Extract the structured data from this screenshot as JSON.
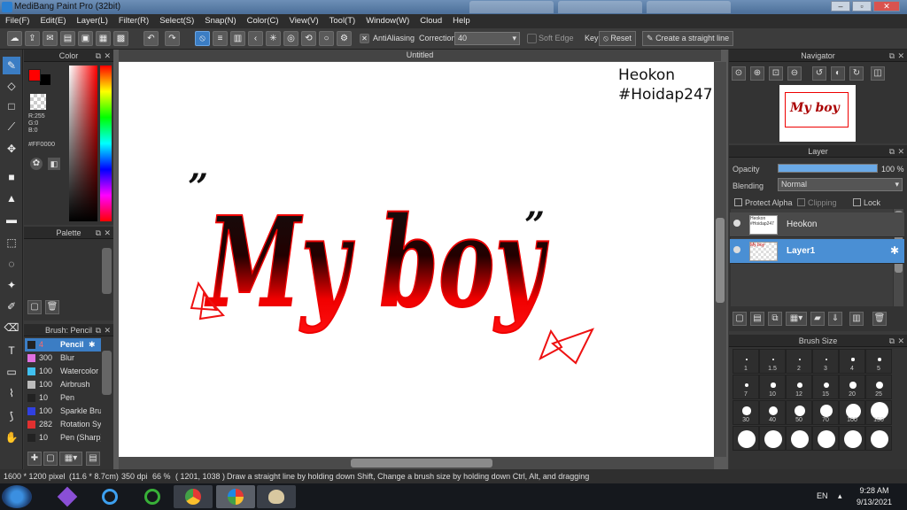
{
  "window": {
    "title": "MediBang Paint Pro (32bit)"
  },
  "menu": [
    "File(F)",
    "Edit(E)",
    "Layer(L)",
    "Filter(R)",
    "Select(S)",
    "Snap(N)",
    "Color(C)",
    "View(V)",
    "Tool(T)",
    "Window(W)",
    "Cloud",
    "Help"
  ],
  "toolbar": {
    "antialiasing_label": "AntiAliasing",
    "correction_label": "Correction",
    "correction_value": "40",
    "soft_edge_label": "Soft Edge",
    "key_label": "Key",
    "reset_label": "Reset",
    "straight_line_label": "Create a straight line"
  },
  "color_panel": {
    "title": "Color",
    "r": "R:255",
    "g": "G:0",
    "b": "B:0",
    "hex": "#FF0000",
    "primary": "#ff0000",
    "secondary": "#000000"
  },
  "palette_panel": {
    "title": "Palette",
    "swatches": [
      "#c8e8a0",
      "#a8e060",
      "#60d020",
      "#70e070",
      "#60c8a0",
      "#a0b8e0",
      "#a8a8f0",
      "#c8a8f0",
      "#e8e880",
      "#40a0f0",
      "#4060f0",
      "#a040f0",
      "#f040a0",
      "#f06020",
      "#f0a020",
      "#a0f040",
      "#f0a0c0",
      "#f0c0a0",
      "#f0e0a0",
      "#40e0e0",
      "#2040c0",
      "#c02020",
      "#802080",
      "#404040"
    ]
  },
  "brush_panel": {
    "title": "Brush: Pencil",
    "items": [
      {
        "size": "4",
        "name": "Pencil",
        "color": "#222222",
        "selected": true
      },
      {
        "size": "300",
        "name": "Blur",
        "color": "#e070e0"
      },
      {
        "size": "100",
        "name": "Watercolor",
        "color": "#40c0f0"
      },
      {
        "size": "100",
        "name": "Airbrush",
        "color": "#bbbbbb"
      },
      {
        "size": "10",
        "name": "Pen",
        "color": "#222222"
      },
      {
        "size": "100",
        "name": "Sparkle Brush",
        "color": "#3040e0"
      },
      {
        "size": "282",
        "name": "Rotation Symmetry",
        "color": "#e03030"
      },
      {
        "size": "10",
        "name": "Pen (Sharp)",
        "color": "#222222"
      }
    ]
  },
  "document": {
    "tab_title": "Untitled",
    "watermark_line1": "Heokon",
    "watermark_line2": "#Hoidap247",
    "artwork_text": "My boy",
    "quote_mark": "”"
  },
  "navigator": {
    "title": "Navigator",
    "preview_text": "My boy"
  },
  "layer_panel": {
    "title": "Layer",
    "opacity_label": "Opacity",
    "opacity_value": "100 %",
    "opacity_level": 1.0,
    "blending_label": "Blending",
    "blending_value": "Normal",
    "protect_alpha_label": "Protect Alpha",
    "clipping_label": "Clipping",
    "lock_label": "Lock",
    "layers": [
      {
        "name": "Heokon",
        "thumb": "Heokon #Hoidap247",
        "selected": false
      },
      {
        "name": "Layer1",
        "thumb": "My boy",
        "selected": true
      }
    ]
  },
  "brush_size_panel": {
    "title": "Brush Size",
    "sizes": [
      "1",
      "1.5",
      "2",
      "3",
      "4",
      "5",
      "7",
      "10",
      "12",
      "15",
      "20",
      "25",
      "30",
      "40",
      "50",
      "70",
      "100",
      "150",
      "",
      "",
      "",
      "",
      "",
      ""
    ]
  },
  "status": {
    "dimensions": "1600 * 1200 pixel",
    "physical": "(11.6 * 8.7cm)",
    "dpi": "350 dpi",
    "zoom": "66 %",
    "cursor": "( 1201, 1038 )",
    "hint": "Draw a straight line by holding down Shift, Change a brush size by holding down Ctrl, Alt, and dragging"
  },
  "taskbar": {
    "lang": "EN",
    "time": "9:28 AM",
    "date": "9/13/2021"
  }
}
